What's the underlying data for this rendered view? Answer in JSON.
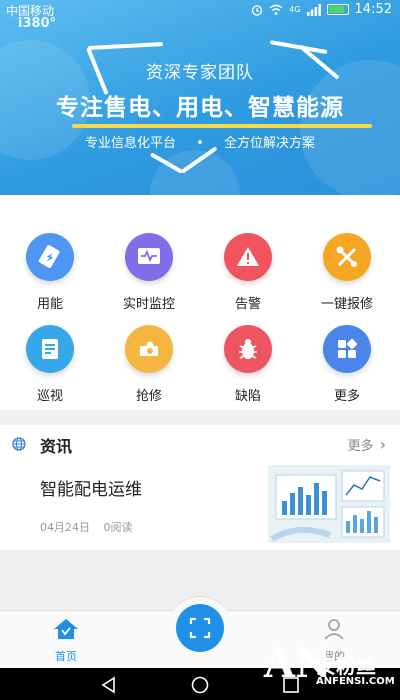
{
  "status_bar": {
    "carrier": "中国移动",
    "time": "14:52",
    "network": "4G"
  },
  "banner": {
    "logo": "i380°",
    "team": "资深专家团队",
    "slogan": "专注售电、用电、智慧能源",
    "sub_left": "专业信息化平台",
    "sub_dot": "•",
    "sub_right": "全方位解决方案"
  },
  "grid": [
    {
      "label": "用能",
      "icon": "battery-icon",
      "color": "#4f96f2"
    },
    {
      "label": "实时监控",
      "icon": "monitor-wave-icon",
      "color": "#7f6ee8"
    },
    {
      "label": "告警",
      "icon": "warning-icon",
      "color": "#f0555f"
    },
    {
      "label": "一键报修",
      "icon": "tools-icon",
      "color": "#f5a623"
    },
    {
      "label": "巡视",
      "icon": "document-icon",
      "color": "#36a8ea"
    },
    {
      "label": "抢修",
      "icon": "repair-icon",
      "color": "#f5b541"
    },
    {
      "label": "缺陷",
      "icon": "bug-icon",
      "color": "#ee5563"
    },
    {
      "label": "更多",
      "icon": "grid-more-icon",
      "color": "#4a86ea"
    }
  ],
  "news": {
    "title": "资讯",
    "more": "更多",
    "headline": "智能配电运维",
    "date": "04月24日",
    "reads": "0阅读"
  },
  "tabbar": {
    "home": "首页",
    "mine": "我的"
  },
  "watermark": {
    "an": "AN",
    "zh": "安粉丝",
    "en": "ANFENSI.COM"
  }
}
